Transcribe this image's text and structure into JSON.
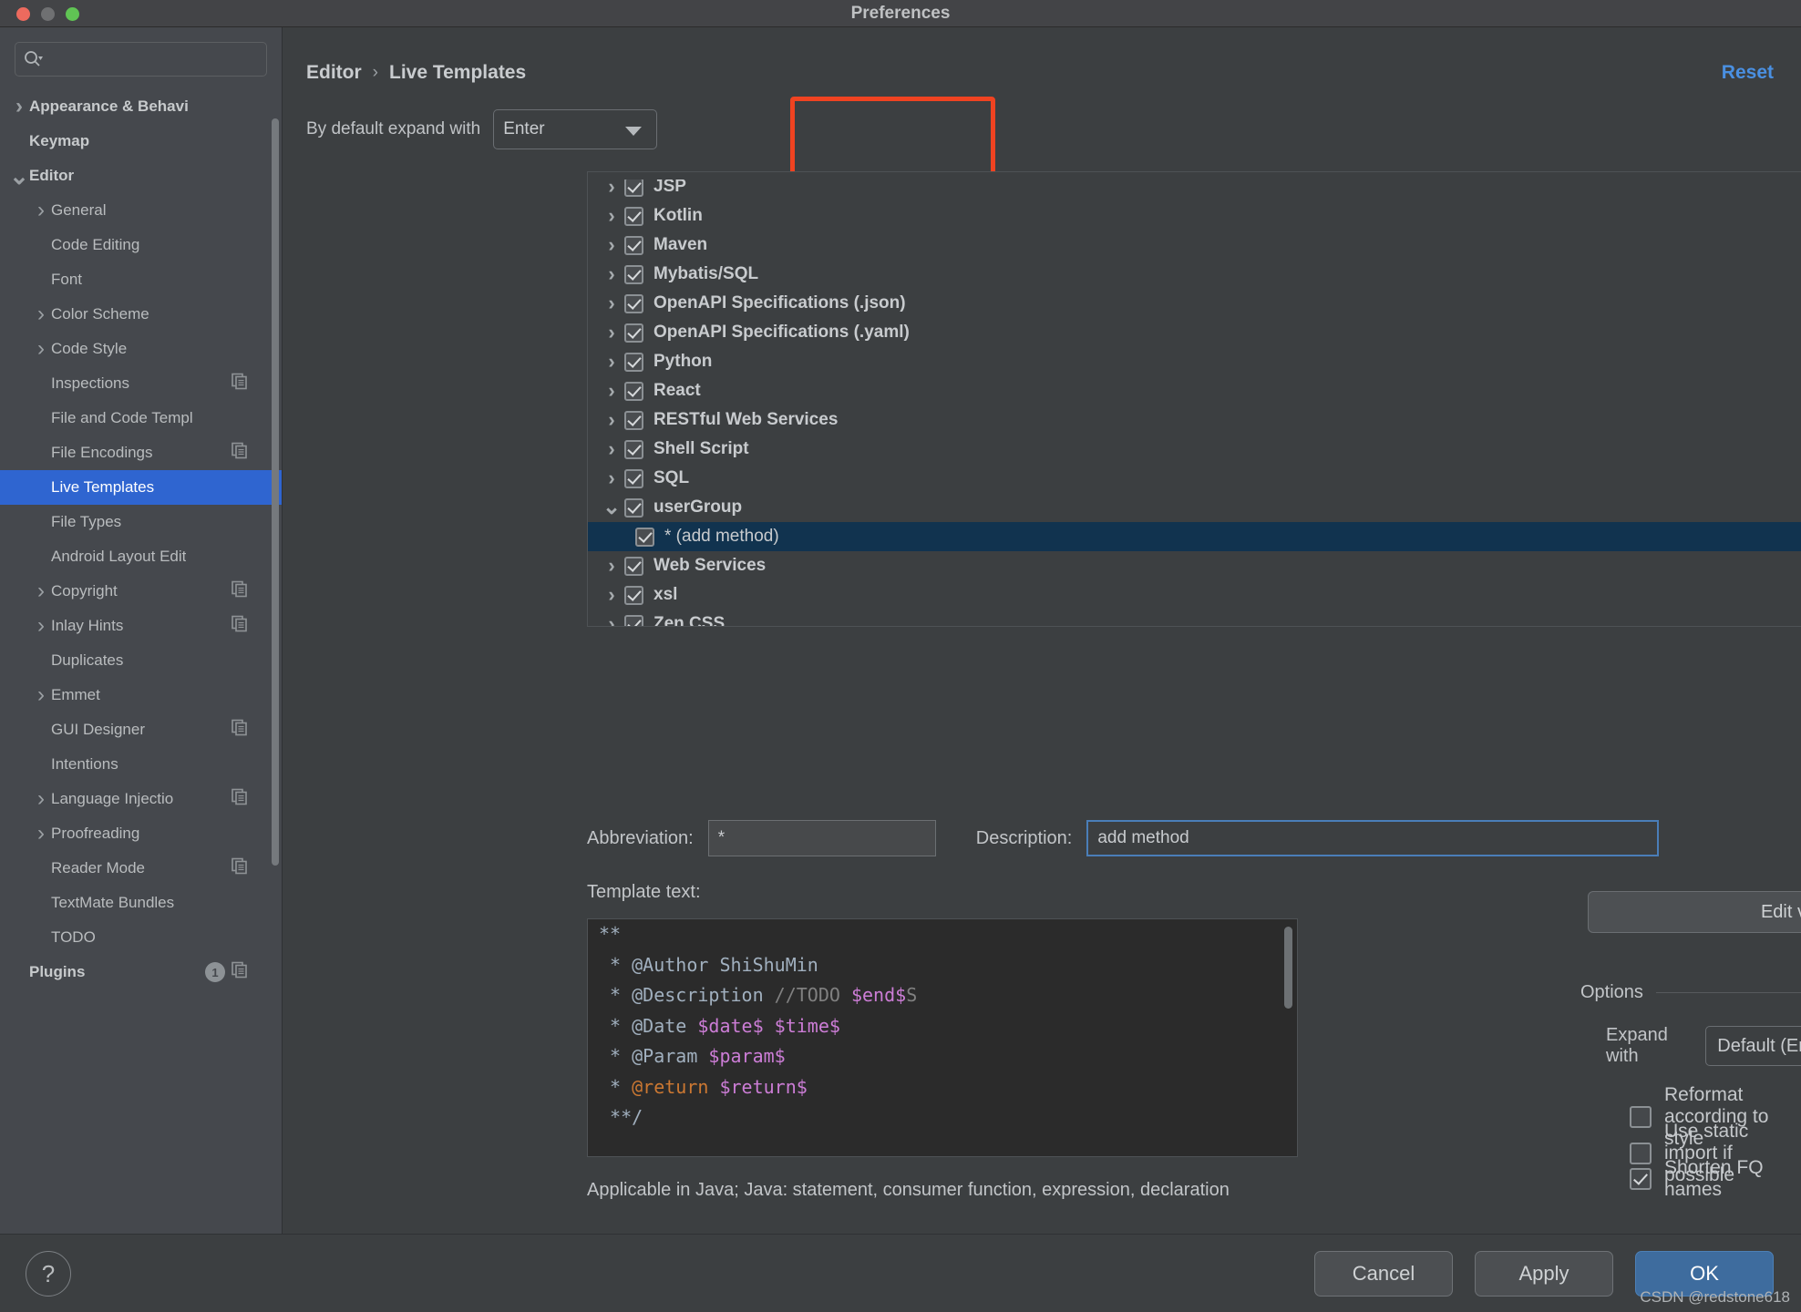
{
  "window": {
    "title": "Preferences",
    "traffic_lights": [
      "close",
      "minimize",
      "zoom"
    ]
  },
  "sidebar": {
    "search": {
      "value": "",
      "placeholder": ""
    },
    "items": [
      {
        "label": "Appearance & Behavi",
        "chevron": "right",
        "indent": 0,
        "bold": true,
        "copy": false,
        "badge": null
      },
      {
        "label": "Keymap",
        "chevron": "none",
        "indent": 0,
        "bold": true,
        "copy": false,
        "badge": null
      },
      {
        "label": "Editor",
        "chevron": "down",
        "indent": 0,
        "bold": true,
        "copy": false,
        "badge": null
      },
      {
        "label": "General",
        "chevron": "right",
        "indent": 1,
        "bold": false,
        "copy": false,
        "badge": null
      },
      {
        "label": "Code Editing",
        "chevron": "none",
        "indent": 1,
        "bold": false,
        "copy": false,
        "badge": null
      },
      {
        "label": "Font",
        "chevron": "none",
        "indent": 1,
        "bold": false,
        "copy": false,
        "badge": null
      },
      {
        "label": "Color Scheme",
        "chevron": "right",
        "indent": 1,
        "bold": false,
        "copy": false,
        "badge": null
      },
      {
        "label": "Code Style",
        "chevron": "right",
        "indent": 1,
        "bold": false,
        "copy": false,
        "badge": null
      },
      {
        "label": "Inspections",
        "chevron": "none",
        "indent": 1,
        "bold": false,
        "copy": true,
        "badge": null
      },
      {
        "label": "File and Code Templ",
        "chevron": "none",
        "indent": 1,
        "bold": false,
        "copy": false,
        "badge": null
      },
      {
        "label": "File Encodings",
        "chevron": "none",
        "indent": 1,
        "bold": false,
        "copy": true,
        "badge": null
      },
      {
        "label": "Live Templates",
        "chevron": "none",
        "indent": 1,
        "bold": false,
        "copy": false,
        "badge": null,
        "selected": true
      },
      {
        "label": "File Types",
        "chevron": "none",
        "indent": 1,
        "bold": false,
        "copy": false,
        "badge": null
      },
      {
        "label": "Android Layout Edit",
        "chevron": "none",
        "indent": 1,
        "bold": false,
        "copy": false,
        "badge": null
      },
      {
        "label": "Copyright",
        "chevron": "right",
        "indent": 1,
        "bold": false,
        "copy": true,
        "badge": null
      },
      {
        "label": "Inlay Hints",
        "chevron": "right",
        "indent": 1,
        "bold": false,
        "copy": true,
        "badge": null
      },
      {
        "label": "Duplicates",
        "chevron": "none",
        "indent": 1,
        "bold": false,
        "copy": false,
        "badge": null
      },
      {
        "label": "Emmet",
        "chevron": "right",
        "indent": 1,
        "bold": false,
        "copy": false,
        "badge": null
      },
      {
        "label": "GUI Designer",
        "chevron": "none",
        "indent": 1,
        "bold": false,
        "copy": true,
        "badge": null
      },
      {
        "label": "Intentions",
        "chevron": "none",
        "indent": 1,
        "bold": false,
        "copy": false,
        "badge": null
      },
      {
        "label": "Language Injectio",
        "chevron": "right",
        "indent": 1,
        "bold": false,
        "copy": true,
        "badge": null
      },
      {
        "label": "Proofreading",
        "chevron": "right",
        "indent": 1,
        "bold": false,
        "copy": false,
        "badge": null
      },
      {
        "label": "Reader Mode",
        "chevron": "none",
        "indent": 1,
        "bold": false,
        "copy": true,
        "badge": null
      },
      {
        "label": "TextMate Bundles",
        "chevron": "none",
        "indent": 1,
        "bold": false,
        "copy": false,
        "badge": null
      },
      {
        "label": "TODO",
        "chevron": "none",
        "indent": 1,
        "bold": false,
        "copy": false,
        "badge": null
      },
      {
        "label": "Plugins",
        "chevron": "none",
        "indent": 0,
        "bold": true,
        "copy": true,
        "badge": "1"
      }
    ]
  },
  "header": {
    "breadcrumb_root": "Editor",
    "breadcrumb_separator": "›",
    "breadcrumb_current": "Live Templates",
    "reset_label": "Reset"
  },
  "expand": {
    "label": "By default expand with",
    "value": "Enter",
    "highlight_color": "#f04321"
  },
  "templates_list": {
    "rows": [
      {
        "label": "JSP",
        "chevron": "right",
        "checked": true,
        "child": false
      },
      {
        "label": "Kotlin",
        "chevron": "right",
        "checked": true,
        "child": false
      },
      {
        "label": "Maven",
        "chevron": "right",
        "checked": true,
        "child": false
      },
      {
        "label": "Mybatis/SQL",
        "chevron": "right",
        "checked": true,
        "child": false
      },
      {
        "label": "OpenAPI Specifications (.json)",
        "chevron": "right",
        "checked": true,
        "child": false
      },
      {
        "label": "OpenAPI Specifications (.yaml)",
        "chevron": "right",
        "checked": true,
        "child": false
      },
      {
        "label": "Python",
        "chevron": "right",
        "checked": true,
        "child": false
      },
      {
        "label": "React",
        "chevron": "right",
        "checked": true,
        "child": false
      },
      {
        "label": "RESTful Web Services",
        "chevron": "right",
        "checked": true,
        "child": false
      },
      {
        "label": "Shell Script",
        "chevron": "right",
        "checked": true,
        "child": false
      },
      {
        "label": "SQL",
        "chevron": "right",
        "checked": true,
        "child": false
      },
      {
        "label": "userGroup",
        "chevron": "down",
        "checked": true,
        "child": false
      },
      {
        "label": "* (add method)",
        "chevron": "none",
        "checked": true,
        "child": true,
        "selected": true
      },
      {
        "label": "Web Services",
        "chevron": "right",
        "checked": true,
        "child": false
      },
      {
        "label": "xsl",
        "chevron": "right",
        "checked": true,
        "child": false
      },
      {
        "label": "Zen CSS",
        "chevron": "right",
        "checked": true,
        "child": false
      }
    ],
    "toolbar": {
      "add": "+",
      "remove": "−",
      "duplicate": "duplicate-icon",
      "revert": "revert-icon"
    }
  },
  "fields": {
    "abbreviation_label": "Abbreviation:",
    "abbreviation_value": "*",
    "description_label": "Description:",
    "description_value": "add method"
  },
  "template_text": {
    "label": "Template text:",
    "lines": [
      [
        {
          "t": "**",
          "c": "doc"
        }
      ],
      [
        {
          "t": " * ",
          "c": "doc"
        },
        {
          "t": "@Author ShiShuMin",
          "c": "doc"
        }
      ],
      [
        {
          "t": " * ",
          "c": "doc"
        },
        {
          "t": "@Description ",
          "c": "doc"
        },
        {
          "t": "//TODO ",
          "c": "comment"
        },
        {
          "t": "$end$",
          "c": "purple"
        },
        {
          "t": "S",
          "c": "comment"
        }
      ],
      [
        {
          "t": " * ",
          "c": "doc"
        },
        {
          "t": "@Date ",
          "c": "doc"
        },
        {
          "t": "$date$ $time$",
          "c": "purple"
        }
      ],
      [
        {
          "t": " * ",
          "c": "doc"
        },
        {
          "t": "@Param ",
          "c": "doc"
        },
        {
          "t": "$param$",
          "c": "purple"
        }
      ],
      [
        {
          "t": " * ",
          "c": "doc"
        },
        {
          "t": "@return ",
          "c": "orange"
        },
        {
          "t": "$return$",
          "c": "purple"
        }
      ],
      [
        {
          "t": " **/",
          "c": "doc"
        }
      ]
    ]
  },
  "options": {
    "edit_variables_label": "Edit variables",
    "section_title": "Options",
    "expand_with_label": "Expand with",
    "expand_with_value": "Default (Enter)",
    "checkboxes": [
      {
        "label": "Reformat according to style",
        "checked": false
      },
      {
        "label": "Use static import if possible",
        "checked": false
      },
      {
        "label": "Shorten FQ names",
        "checked": true
      }
    ]
  },
  "applicable": {
    "text": "Applicable in Java; Java: statement, consumer function, expression, declaration"
  },
  "footer": {
    "help_label": "?",
    "cancel_label": "Cancel",
    "apply_label": "Apply",
    "ok_label": "OK",
    "watermark": "CSDN @redstone618"
  },
  "colors": {
    "accent_blue": "#2f65d0",
    "link_blue": "#4a90e2",
    "primary_button": "#3e6c9e",
    "highlight_red": "#f04321",
    "selected_row": "#11334f"
  }
}
